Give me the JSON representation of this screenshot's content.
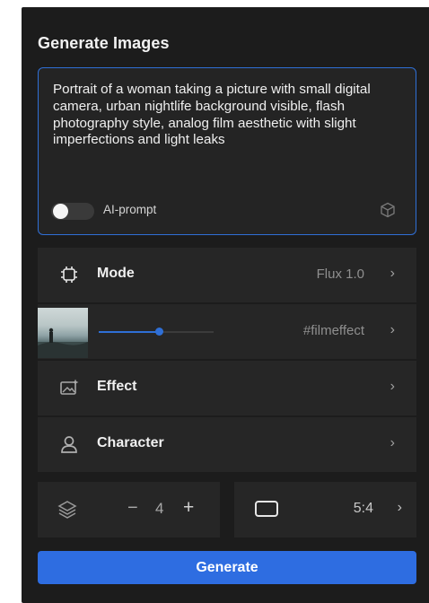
{
  "panel": {
    "title": "Generate Images"
  },
  "prompt": {
    "text": "Portrait of a woman taking a picture with small digital camera, urban nightlife background visible, flash photography style, analog film aesthetic with slight imperfections and light leaks",
    "ai_prompt_label": "AI-prompt",
    "ai_prompt_enabled": false
  },
  "rows": {
    "mode": {
      "label": "Mode",
      "value": "Flux 1.0",
      "icon": "chip-icon"
    },
    "style": {
      "value": "#filmeffect",
      "slider_level": 0.52,
      "icon": "style-thumbnail"
    },
    "effect": {
      "label": "Effect",
      "icon": "image-sparkle-icon"
    },
    "character": {
      "label": "Character",
      "icon": "user-icon"
    }
  },
  "count": {
    "minus": "−",
    "value": "4",
    "plus": "+",
    "icon": "layers-icon"
  },
  "aspect": {
    "value": "5:4",
    "icon": "rectangle-icon"
  },
  "chevron": "›",
  "generate_label": "Generate",
  "colors": {
    "accent": "#2e6de1",
    "panel_bg": "#1c1c1c",
    "row_bg": "#262626"
  }
}
